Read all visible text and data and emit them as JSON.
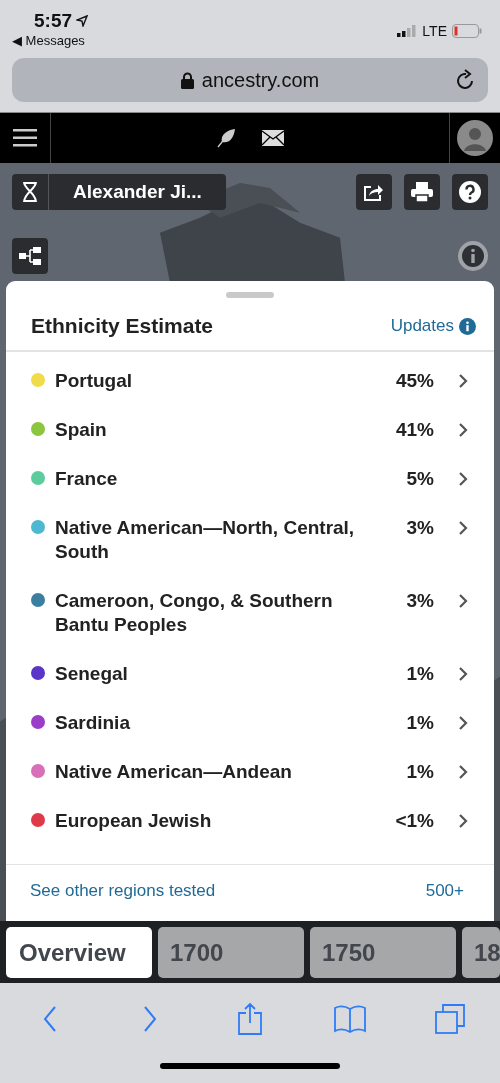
{
  "status_bar": {
    "time": "5:57",
    "back_label": "◀ Messages",
    "network": "LTE"
  },
  "url_bar": {
    "address": "ancestry.com"
  },
  "toolbar": {
    "name": "Alexander Ji..."
  },
  "card": {
    "title": "Ethnicity Estimate",
    "updates_link": "Updates",
    "regions": [
      {
        "name": "Portugal",
        "percent": "45%",
        "color": "#f0dc4a"
      },
      {
        "name": "Spain",
        "percent": "41%",
        "color": "#8cc63f"
      },
      {
        "name": "France",
        "percent": "5%",
        "color": "#5ccc9c"
      },
      {
        "name": "Native American—North, Central, South",
        "percent": "3%",
        "color": "#4db8d0"
      },
      {
        "name": "Cameroon, Congo, & Southern Bantu Peoples",
        "percent": "3%",
        "color": "#3a7fa0"
      },
      {
        "name": "Senegal",
        "percent": "1%",
        "color": "#5a35c8"
      },
      {
        "name": "Sardinia",
        "percent": "1%",
        "color": "#9a3ec8"
      },
      {
        "name": "Native American—Andean",
        "percent": "1%",
        "color": "#d870b8"
      },
      {
        "name": "European Jewish",
        "percent": "<1%",
        "color": "#e0394a"
      }
    ],
    "footer_link": "See other regions tested",
    "footer_count": "500+"
  },
  "tabs": [
    {
      "label": "Overview",
      "selected": true
    },
    {
      "label": "1700",
      "selected": false
    },
    {
      "label": "1750",
      "selected": false
    },
    {
      "label": "18",
      "selected": false
    }
  ]
}
